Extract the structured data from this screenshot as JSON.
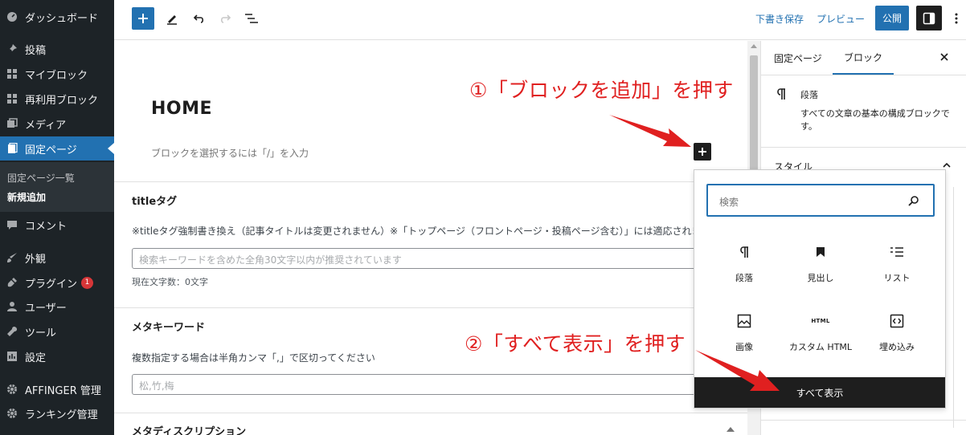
{
  "sidebar": {
    "items": [
      {
        "label": "ダッシュボード",
        "icon": "dashboard-icon"
      },
      {
        "label": "投稿",
        "icon": "pin-icon"
      },
      {
        "label": "マイブロック",
        "icon": "grid-icon"
      },
      {
        "label": "再利用ブロック",
        "icon": "grid-icon"
      },
      {
        "label": "メディア",
        "icon": "media-icon"
      },
      {
        "label": "固定ページ",
        "icon": "page-icon"
      },
      {
        "label": "コメント",
        "icon": "comment-icon"
      },
      {
        "label": "外観",
        "icon": "brush-icon"
      },
      {
        "label": "プラグイン",
        "icon": "plugin-icon",
        "badge": "1"
      },
      {
        "label": "ユーザー",
        "icon": "user-icon"
      },
      {
        "label": "ツール",
        "icon": "wrench-icon"
      },
      {
        "label": "設定",
        "icon": "settings-icon"
      },
      {
        "label": "AFFINGER 管理",
        "icon": "gear-icon"
      },
      {
        "label": "ランキング管理",
        "icon": "gear-icon"
      }
    ],
    "submenu": [
      "固定ページ一覧",
      "新規追加"
    ]
  },
  "toolbar": {
    "draft_label": "下書き保存",
    "preview_label": "プレビュー",
    "publish_label": "公開"
  },
  "editor": {
    "page_title": "HOME",
    "block_placeholder": "ブロックを選択するには「/」を入力",
    "meta": {
      "title_tag": {
        "heading": "titleタグ",
        "description": "※titleタグ強制書き換え（記事タイトルは変更されません）※「トップページ（フロントページ・投稿ページ含む）」には適応されま",
        "placeholder": "検索キーワードを含めた全角30文字以内が推奨されています",
        "char_count": "現在文字数：0文字"
      },
      "meta_keywords": {
        "heading": "メタキーワード",
        "description": "複数指定する場合は半角カンマ「,」で区切ってください",
        "placeholder": "松,竹,梅"
      },
      "meta_description": {
        "heading": "メタディスクリプション"
      }
    }
  },
  "settings_panel": {
    "tabs": [
      "固定ページ",
      "ブロック"
    ],
    "block_title": "段落",
    "block_description": "すべての文章の基本の構成ブロックです。",
    "style_heading": "スタイル"
  },
  "inserter": {
    "search_placeholder": "検索",
    "blocks": [
      {
        "label": "段落",
        "icon": "paragraph-icon"
      },
      {
        "label": "見出し",
        "icon": "bookmark-icon"
      },
      {
        "label": "リスト",
        "icon": "list-icon"
      },
      {
        "label": "画像",
        "icon": "image-icon"
      },
      {
        "label": "カスタム HTML",
        "icon": "html-icon",
        "icon_text": "HTML"
      },
      {
        "label": "埋め込み",
        "icon": "embed-icon"
      }
    ],
    "show_all_label": "すべて表示"
  },
  "annotations": {
    "step1": "①「ブロックを追加」を押す",
    "step2": "②「すべて表示」を押す"
  },
  "colors": {
    "sidebar_bg": "#1d2327",
    "accent": "#2271b1",
    "annotation": "#e02020"
  }
}
